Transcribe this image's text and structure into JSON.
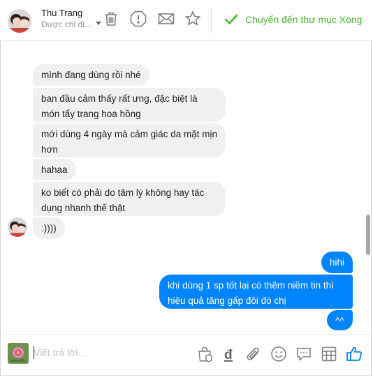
{
  "header": {
    "name": "Thu Trang",
    "subtitle": "Được chỉ đị...",
    "done_label": "Chuyển đến thư mục Xong",
    "icons": [
      "trash-icon",
      "exclamation-icon",
      "envelope-icon",
      "star-icon"
    ]
  },
  "messages": [
    {
      "side": "in",
      "text": "mình đang dùng rồi nhé"
    },
    {
      "side": "in",
      "text": "ban đầu cảm thấy rất ưng, đặc biệt là món tẩy trang hoa hồng"
    },
    {
      "side": "in",
      "text": "mới dùng 4 ngày mà cảm giác da mặt mịn hơn"
    },
    {
      "side": "in",
      "text": "hahaa"
    },
    {
      "side": "in",
      "text": "ko biết có phải do tâm lý không hay tác dụng nhanh thế thật"
    },
    {
      "side": "in",
      "text": ":))))"
    },
    {
      "side": "out",
      "text": "hihi"
    },
    {
      "side": "out",
      "text": "khi dùng 1 sp tốt lại có thêm niềm tin thì hiệu quả tăng gấp đôi đó chị"
    },
    {
      "side": "out",
      "text": "^^"
    }
  ],
  "composer": {
    "placeholder": "Viết trả lời...",
    "icons": [
      "gift-bag-icon",
      "dong-currency-icon",
      "paperclip-icon",
      "smiley-icon",
      "speech-bubble-icon",
      "table-icon",
      "thumbs-up-icon"
    ]
  },
  "colors": {
    "accent_blue": "#0084ff",
    "done_green": "#42b72a",
    "bubble_gray": "#f1f0f0"
  }
}
